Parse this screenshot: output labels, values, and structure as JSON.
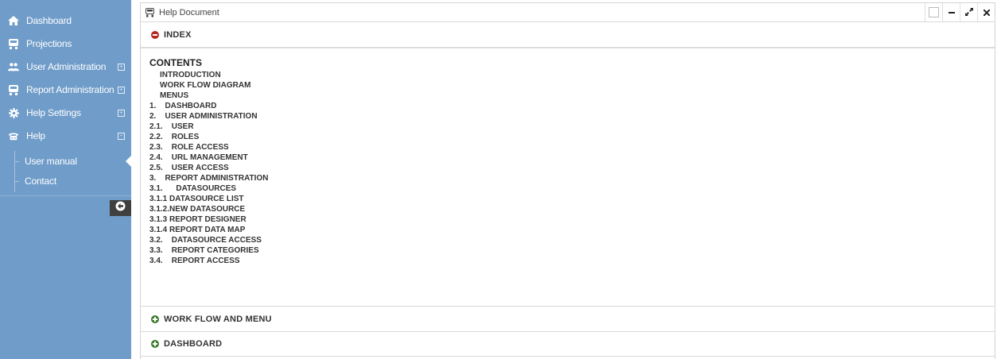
{
  "sidebar": {
    "items": [
      {
        "label": "Dashboard",
        "icon": "home-icon",
        "expander": ""
      },
      {
        "label": "Projections",
        "icon": "projector-icon",
        "expander": ""
      },
      {
        "label": "User Administration",
        "icon": "users-icon",
        "expander": "+"
      },
      {
        "label": "Report Administration",
        "icon": "report-icon",
        "expander": "+"
      },
      {
        "label": "Help Settings",
        "icon": "gear-icon",
        "expander": "+"
      },
      {
        "label": "Help",
        "icon": "help-icon",
        "expander": "−"
      }
    ],
    "sub_items": [
      {
        "label": "User manual"
      },
      {
        "label": "Contact"
      }
    ]
  },
  "panel": {
    "title": "Help Document",
    "icon": "document-icon"
  },
  "sections": [
    {
      "label": "INDEX",
      "state": "open"
    },
    {
      "label": "WORK FLOW AND MENU",
      "state": "collapsed"
    },
    {
      "label": "DASHBOARD",
      "state": "collapsed"
    }
  ],
  "index": {
    "heading": "CONTENTS",
    "entries": [
      "INTRODUCTION",
      "WORK FLOW DIAGRAM",
      "MENUS",
      "1.    DASHBOARD",
      "2.    USER ADMINISTRATION",
      "2.1.    USER",
      "2.2.    ROLES",
      "2.3.    ROLE ACCESS",
      "2.4.    URL MANAGEMENT",
      "2.5.    USER ACCESS",
      "3.    REPORT ADMINISTRATION",
      "3.1.      DATASOURCES",
      "3.1.1 DATASOURCE LIST",
      "3.1.2.NEW DATASOURCE",
      "3.1.3 REPORT DESIGNER",
      "3.1.4 REPORT DATA MAP",
      "3.2.    DATASOURCE ACCESS",
      "3.3.    REPORT CATEGORIES",
      "3.4.    REPORT ACCESS"
    ]
  },
  "colors": {
    "sidebar_bg": "#6f9cc9",
    "open_icon": "#b5261e",
    "collapsed_icon": "#3c7a2e"
  }
}
